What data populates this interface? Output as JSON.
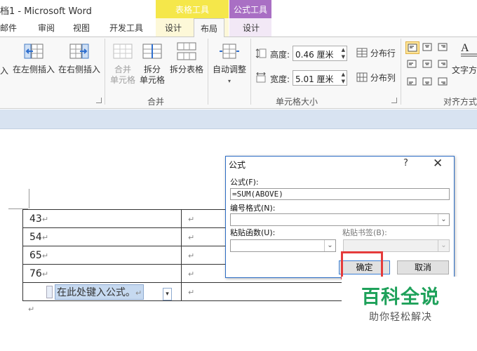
{
  "window": {
    "title": "档1 - Microsoft Word"
  },
  "context_tabs": {
    "table_tools": "表格工具",
    "formula_tools": "公式工具"
  },
  "tabs": [
    "邮件",
    "审阅",
    "视图",
    "开发工具",
    "设计",
    "布局",
    "设计"
  ],
  "ribbon": {
    "insert_partial": "入",
    "insert_left": "在左侧插入",
    "insert_right": "在右侧插入",
    "merge_cells": [
      "合并",
      "单元格"
    ],
    "split_cells": [
      "拆分",
      "单元格"
    ],
    "split_table": "拆分表格",
    "autofit": "自动调整",
    "group_merge": "合并",
    "height_label": "高度:",
    "height_value": "0.46 厘米",
    "width_label": "宽度:",
    "width_value": "5.01 厘米",
    "distribute_rows": "分布行",
    "distribute_cols": "分布列",
    "group_cell_size": "单元格大小",
    "text_direction": "文字方",
    "group_alignment": "对齐方式"
  },
  "table": {
    "rows": [
      "43",
      "54",
      "65",
      "76"
    ],
    "formula_field": "在此处键入公式。",
    "paragraph_mark": "↵"
  },
  "dialog": {
    "title": "公式",
    "help": "?",
    "close": "✕",
    "formula_label": "公式(F):",
    "formula_value": "=SUM(ABOVE)",
    "number_format_label": "编号格式(N):",
    "paste_function_label": "粘贴函数(U):",
    "paste_bookmark_label": "粘贴书签(B):",
    "ok": "确定",
    "cancel": "取消"
  },
  "watermark": {
    "main": "百科全说",
    "sub": "助你轻松解决"
  },
  "colors": {
    "table_tools": "#f5e74a",
    "formula_tools": "#a96fc4",
    "highlight": "#e53b3b",
    "watermark": "#1ea15a"
  }
}
